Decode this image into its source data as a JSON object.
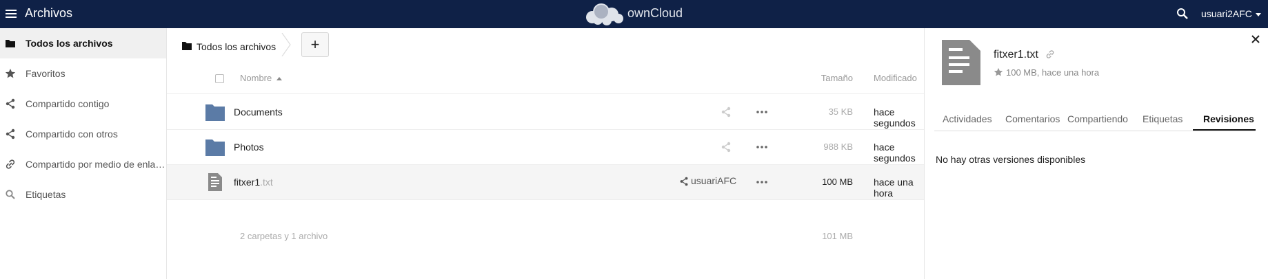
{
  "header": {
    "app_name": "Archivos",
    "logo_text": "ownCloud",
    "user": "usuari2AFC"
  },
  "sidebar": {
    "items": [
      {
        "label": "Todos los archivos",
        "icon": "folder-icon",
        "active": true
      },
      {
        "label": "Favoritos",
        "icon": "star-icon"
      },
      {
        "label": "Compartido contigo",
        "icon": "share-icon"
      },
      {
        "label": "Compartido con otros",
        "icon": "share-icon"
      },
      {
        "label": "Compartido por medio de enla…",
        "icon": "link-icon"
      },
      {
        "label": "Etiquetas",
        "icon": "tag-search-icon"
      }
    ]
  },
  "breadcrumb": {
    "label": "Todos los archivos",
    "new_button": "+"
  },
  "table": {
    "headers": {
      "name": "Nombre",
      "size": "Tamaño",
      "modified": "Modificado"
    },
    "rows": [
      {
        "name": "Documents",
        "ext": "",
        "type": "folder",
        "size": "35 KB",
        "modified": "hace segundos"
      },
      {
        "name": "Photos",
        "ext": "",
        "type": "folder",
        "size": "988 KB",
        "modified": "hace segundos"
      },
      {
        "name": "fitxer1",
        "ext": ".txt",
        "type": "file",
        "shared_with": "usuariAFC",
        "size": "100 MB",
        "modified": "hace una hora"
      }
    ],
    "summary": {
      "text": "2 carpetas y 1 archivo",
      "size": "101 MB"
    }
  },
  "details": {
    "file_name": "fitxer1.txt",
    "meta": "100 MB, hace una hora",
    "tabs": [
      "Actividades",
      "Comentarios",
      "Compartiendo",
      "Etiquetas",
      "Revisiones"
    ],
    "active_tab": "Revisiones",
    "empty_message": "No hay otras versiones disponibles"
  },
  "colors": {
    "header_bg": "#0f2147",
    "folder": "#5b7ba6"
  }
}
